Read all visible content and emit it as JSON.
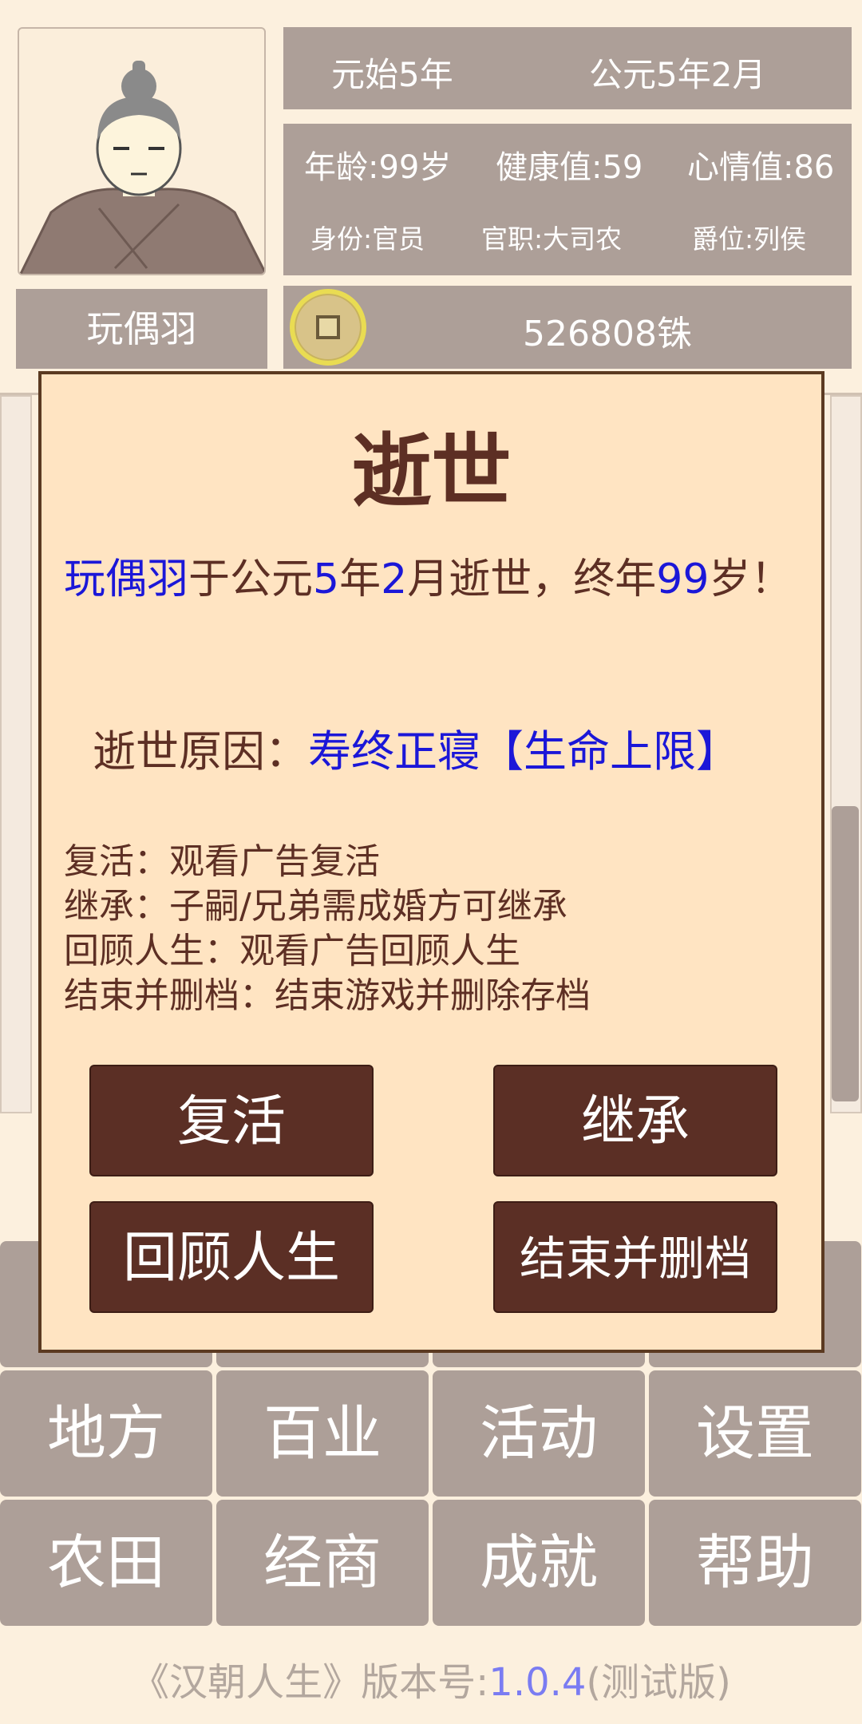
{
  "header": {
    "era_date": "元始5年",
    "gregorian_date": "公元5年2月",
    "age": "年龄:99岁",
    "health": "健康值:59",
    "mood": "心情值:86",
    "identity": "身份:官员",
    "official_post": "官职:大司农",
    "noble_rank": "爵位:列侯",
    "player_name": "玩偶羽",
    "money": "526808铢"
  },
  "dialog": {
    "title": "逝世",
    "message": {
      "name": "玩偶羽",
      "t1": "于公元",
      "year": "5",
      "t2": "年",
      "month": "2",
      "t3": "月逝世，终年",
      "age": "99",
      "t4": "岁！"
    },
    "cause_label": "逝世原因：",
    "cause_value": "寿终正寝【生命上限】",
    "explanations": [
      "复活：观看广告复活",
      "继承：子嗣/兄弟需成婚方可继承",
      "回顾人生：观看广告回顾人生",
      "结束并删档：结束游戏并删除存档"
    ],
    "buttons": {
      "revive": "复活",
      "inherit": "继承",
      "review": "回顾人生",
      "end_delete": "结束并删档"
    }
  },
  "menu": {
    "row1": [
      "地方",
      "百业",
      "活动",
      "设置"
    ],
    "row2": [
      "农田",
      "经商",
      "成就",
      "帮助"
    ]
  },
  "footer": {
    "prefix": "《汉朝人生》版本号:",
    "version": "1.0.4",
    "suffix": "(测试版)"
  },
  "colors": {
    "background": "#fcf0de",
    "panel": "#ad9f98",
    "dialog_bg": "#ffe4c2",
    "dialog_text": "#5d2f24",
    "highlight_blue": "#1b17d8",
    "button_bg": "#5b2f25"
  }
}
